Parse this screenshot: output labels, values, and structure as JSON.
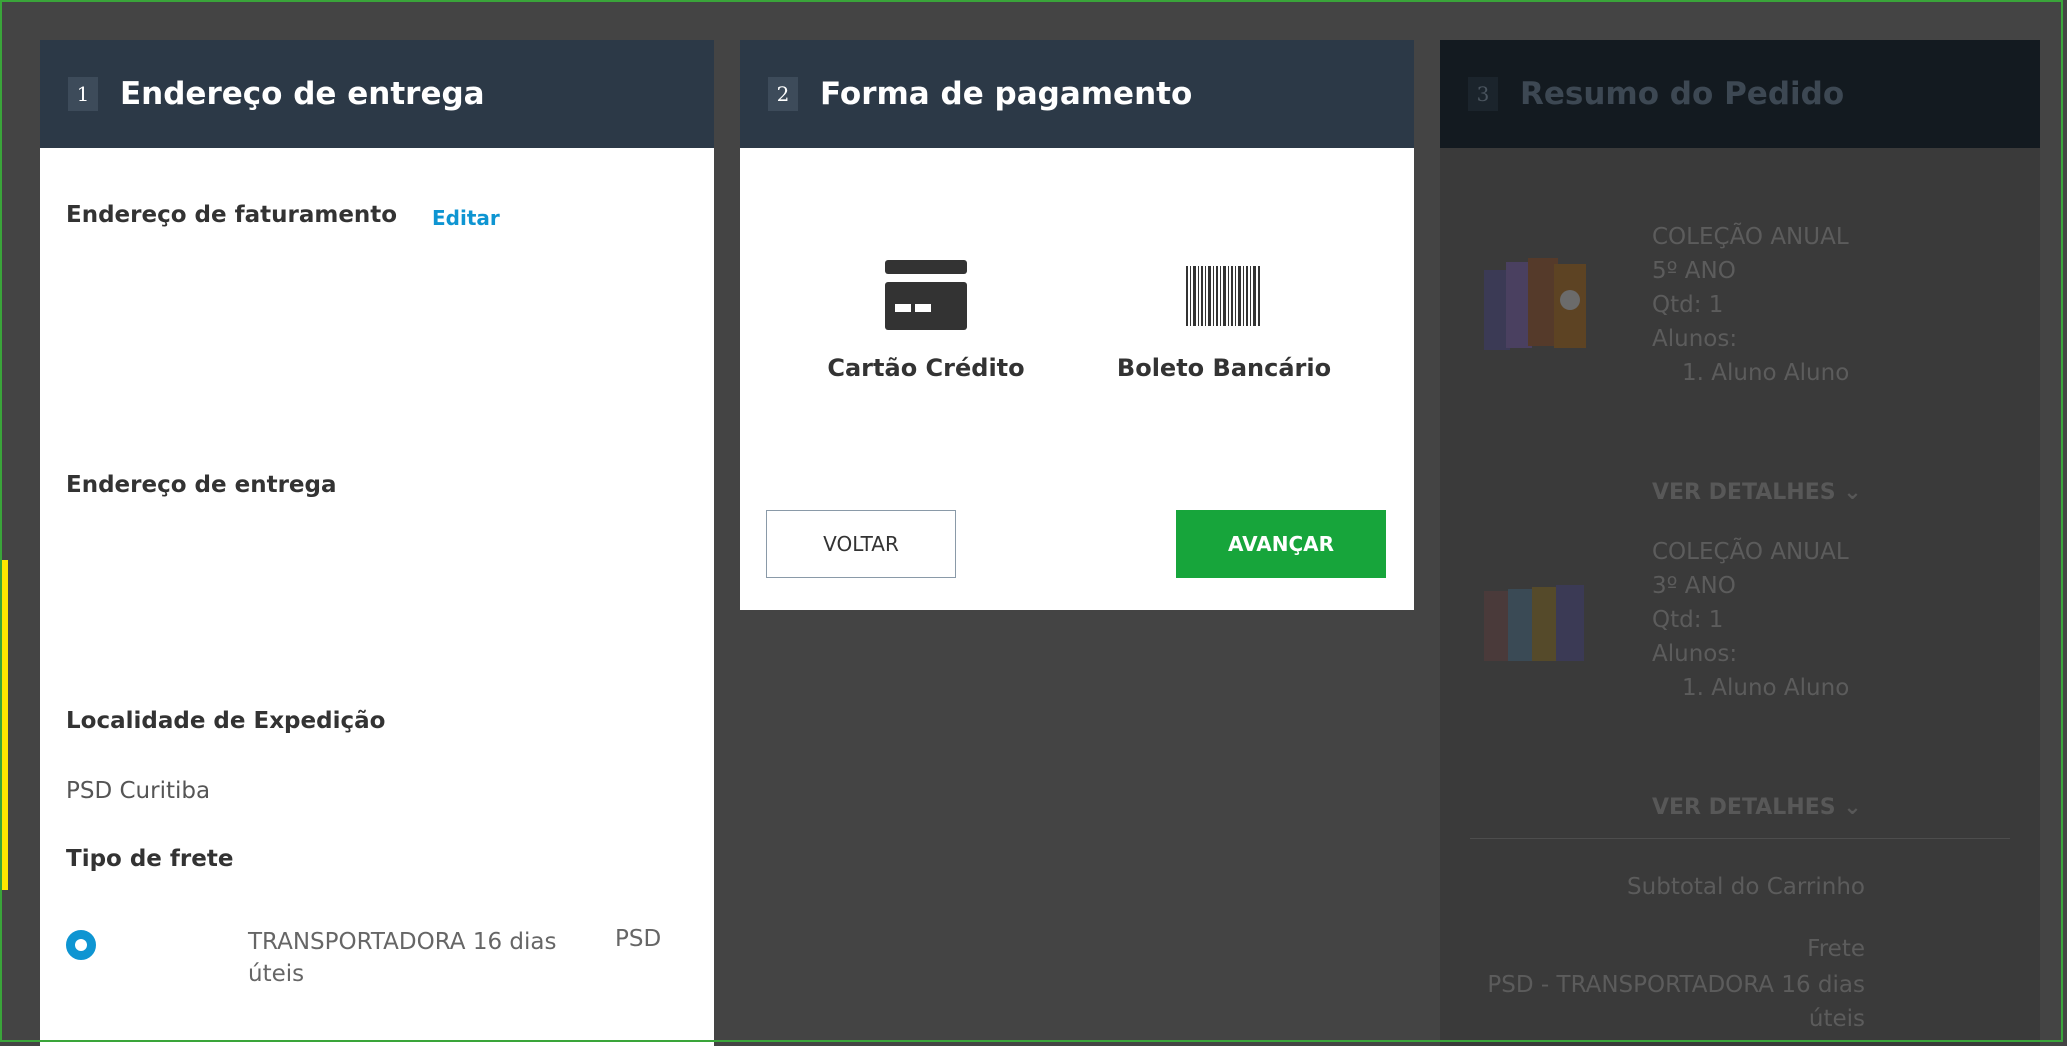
{
  "steps": [
    {
      "num": "1",
      "title": "Endereço de entrega"
    },
    {
      "num": "2",
      "title": "Forma de pagamento"
    },
    {
      "num": "3",
      "title": "Resumo do Pedido"
    }
  ],
  "address": {
    "billing_label": "Endereço de faturamento",
    "edit_label": "Editar",
    "delivery_label": "Endereço de entrega",
    "dispatch_label": "Localidade de Expedição",
    "dispatch_value": "PSD Curitiba",
    "freight_label": "Tipo de frete",
    "freight_option": "TRANSPORTADORA 16 dias úteis",
    "freight_carrier": "PSD"
  },
  "payment": {
    "card_label": "Cartão Crédito",
    "boleto_label": "Boleto Bancário",
    "back_label": "VOLTAR",
    "next_label": "AVANÇAR"
  },
  "summary": {
    "items": [
      {
        "title": "COLEÇÃO ANUAL 5º ANO",
        "qty": "Qtd: 1",
        "students_label": "Alunos:",
        "student": "1. Aluno Aluno",
        "details": "VER DETALHES"
      },
      {
        "title": "COLEÇÃO ANUAL 3º ANO",
        "qty": "Qtd: 1",
        "students_label": "Alunos:",
        "student": "1. Aluno Aluno",
        "details": "VER DETALHES"
      }
    ],
    "subtotal_label": "Subtotal do Carrinho",
    "freight_label": "Frete",
    "freight_desc": "PSD - TRANSPORTADORA 16 dias úteis"
  },
  "colors": {
    "header": "#2c3947",
    "accent": "#0e95d2",
    "primary_button": "#17a53b",
    "overlay": "#444444"
  },
  "icons": {
    "card": "credit-card-icon",
    "boleto": "barcode-icon",
    "chevron": "chevron-down-icon"
  }
}
